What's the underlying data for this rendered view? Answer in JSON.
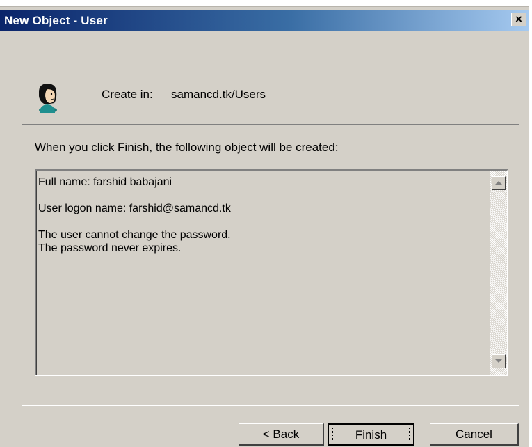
{
  "window": {
    "title": "New Object - User",
    "close_symbol": "×"
  },
  "header": {
    "icon": "user-icon",
    "create_in_label": "Create in:",
    "create_in_path": "samancd.tk/Users"
  },
  "intro_text": "When you click Finish, the following object will be created:",
  "summary_lines": [
    "Full name: farshid babajani",
    "",
    "User logon name: farshid@samancd.tk",
    "",
    "The user cannot change the password.",
    "The password never expires."
  ],
  "buttons": {
    "back_prefix": "< ",
    "back_mnemonic": "B",
    "back_rest": "ack",
    "finish": "Finish",
    "cancel": "Cancel"
  },
  "colors": {
    "title_gradient_start": "#0a246a",
    "title_gradient_end": "#a6caf0",
    "dialog_bg": "#d4d0c8"
  }
}
